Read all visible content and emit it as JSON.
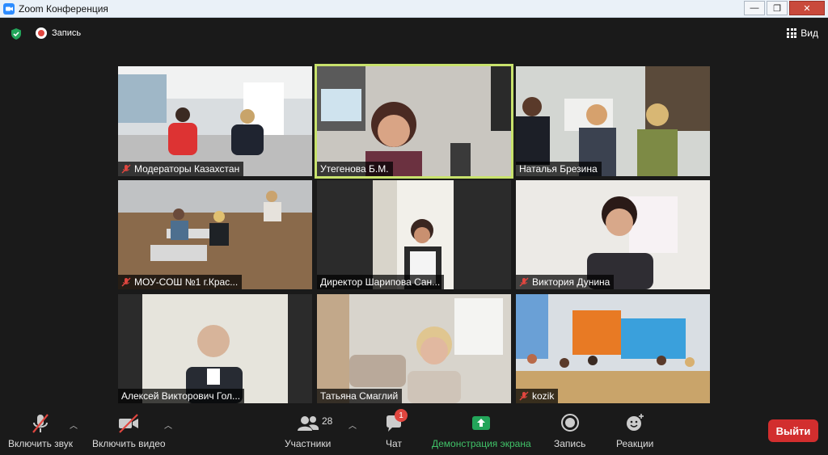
{
  "window": {
    "title": "Zoom Конференция",
    "minimize": "—",
    "maximize": "❐",
    "close": "✕"
  },
  "topbar": {
    "record_label": "Запись",
    "view_label": "Вид"
  },
  "participants_grid": [
    {
      "name": "Модераторы Казахстан",
      "muted": true,
      "active": false
    },
    {
      "name": "Утегенова Б.М.",
      "muted": false,
      "active": true
    },
    {
      "name": "Наталья Брезина",
      "muted": false,
      "active": false
    },
    {
      "name": "МОУ-СОШ №1 г.Крас...",
      "muted": true,
      "active": false
    },
    {
      "name": "Директор Шарипова Сан...",
      "muted": false,
      "active": false
    },
    {
      "name": "Виктория Дунина",
      "muted": true,
      "active": false
    },
    {
      "name": "Алексей Викторович Гол...",
      "muted": false,
      "active": false
    },
    {
      "name": "Татьяна Смаглий",
      "muted": false,
      "active": false
    },
    {
      "name": "kozik",
      "muted": true,
      "active": false
    }
  ],
  "toolbar": {
    "audio": "Включить звук",
    "video": "Включить видео",
    "participants": "Участники",
    "participants_count": "28",
    "chat": "Чат",
    "chat_badge": "1",
    "share": "Демонстрация экрана",
    "record": "Запись",
    "reactions": "Реакции",
    "leave": "Выйти"
  },
  "colors": {
    "share_green": "#40c268",
    "leave_red": "#d22e2e",
    "active_border": "#c8e26c",
    "muted_red": "#e0463f"
  }
}
